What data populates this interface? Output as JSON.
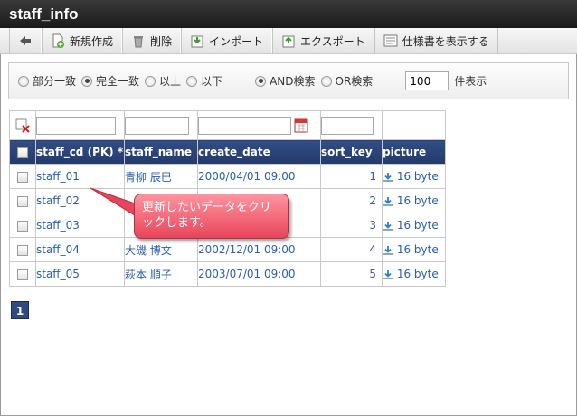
{
  "window": {
    "title": "staff_info"
  },
  "toolbar": {
    "back_icon": "back-arrow-icon",
    "new_label": "新規作成",
    "delete_label": "削除",
    "import_label": "インポート",
    "export_label": "エクスポート",
    "spec_label": "仕様書を表示する"
  },
  "search": {
    "options": [
      "部分一致",
      "完全一致",
      "以上",
      "以下"
    ],
    "selected_match": "完全一致",
    "logic": [
      "AND検索",
      "OR検索"
    ],
    "selected_logic": "AND検索",
    "count_value": "100",
    "count_suffix": "件表示"
  },
  "table": {
    "headers": [
      "staff_cd (PK) *",
      "staff_name",
      "create_date",
      "sort_key",
      "picture"
    ],
    "rows": [
      {
        "staff_cd": "staff_01",
        "staff_name": "青柳 辰巳",
        "create_date": "2000/04/01 09:00",
        "sort_key": "1",
        "picture": "16 byte"
      },
      {
        "staff_cd": "staff_02",
        "staff_name": "",
        "create_date": "",
        "sort_key": "2",
        "picture": "16 byte"
      },
      {
        "staff_cd": "staff_03",
        "staff_name": "",
        "create_date": "",
        "sort_key": "3",
        "picture": "16 byte"
      },
      {
        "staff_cd": "staff_04",
        "staff_name": "大磯 博文",
        "create_date": "2002/12/01 09:00",
        "sort_key": "4",
        "picture": "16 byte"
      },
      {
        "staff_cd": "staff_05",
        "staff_name": "萩本 順子",
        "create_date": "2003/07/01 09:00",
        "sort_key": "5",
        "picture": "16 byte"
      }
    ]
  },
  "pager": {
    "current": "1"
  },
  "callout": {
    "text": "更新したいデータをクリックします。"
  },
  "colors": {
    "header_bg": "#2b4479",
    "link": "#2a5db0",
    "callout": "#f0606f",
    "titlebar": "#2a2a2a"
  }
}
